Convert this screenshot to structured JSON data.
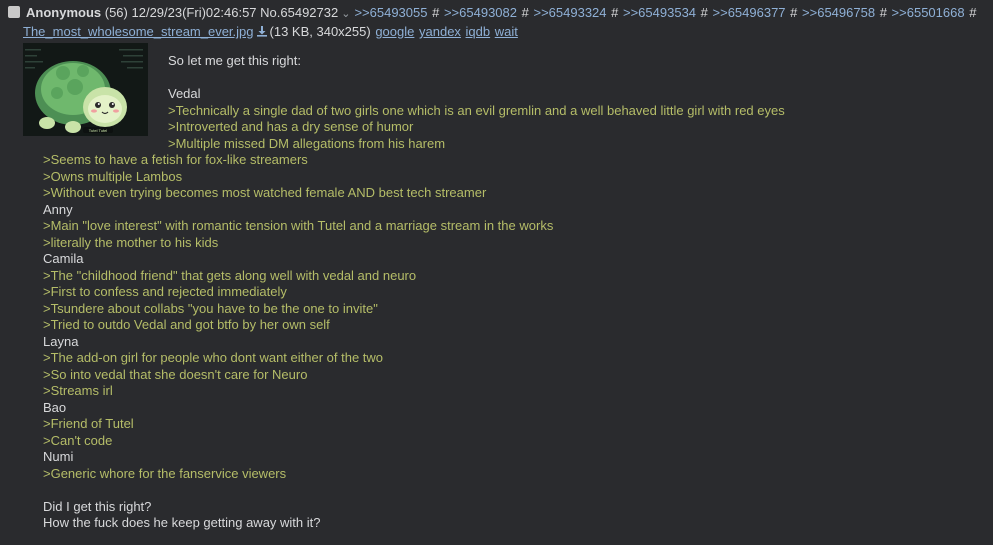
{
  "header": {
    "name": "Anonymous",
    "post_count": "(56)",
    "datetime": "12/29/23(Fri)02:46:57",
    "post_no": "No.65492732",
    "menu_icon": "chevron-down-icon",
    "backlinks": [
      ">>65493055",
      ">>65493082",
      ">>65493324",
      ">>65493534",
      ">>65496377",
      ">>65496758",
      ">>65501668"
    ],
    "backlink_sep": "#"
  },
  "file": {
    "filename": "The_most_wholesome_stream_ever.jpg",
    "download_icon": "download-icon",
    "info": "(13 KB, 340x255)",
    "search_links": [
      "google",
      "yandex",
      "iqdb",
      "wait"
    ],
    "thumb_caption": "Tutel Tutel"
  },
  "message_top": [
    {
      "text": "So let me get this right:",
      "green": false
    },
    {
      "text": "",
      "green": false
    },
    {
      "text": "Vedal",
      "green": false
    },
    {
      "text": ">Technically a single dad of two girls one which is an evil gremlin and a well behaved little girl with red eyes",
      "green": true
    },
    {
      "text": ">Introverted and has a dry sense of humor",
      "green": true
    },
    {
      "text": ">Multiple missed DM allegations from his harem",
      "green": true
    }
  ],
  "message_bottom": [
    {
      "text": ">Seems to have a fetish for fox-like streamers",
      "green": true
    },
    {
      "text": ">Owns multiple Lambos",
      "green": true
    },
    {
      "text": ">Without even trying becomes most watched female AND best tech streamer",
      "green": true
    },
    {
      "text": "Anny",
      "green": false
    },
    {
      "text": ">Main \"love interest\" with romantic tension with Tutel and a marriage stream in the works",
      "green": true
    },
    {
      "text": ">literally the mother to his kids",
      "green": true
    },
    {
      "text": "Camila",
      "green": false
    },
    {
      "text": ">The \"childhood friend\" that gets along well with vedal and neuro",
      "green": true
    },
    {
      "text": ">First to confess and rejected immediately",
      "green": true
    },
    {
      "text": ">Tsundere about collabs \"you have to be the one to invite\"",
      "green": true
    },
    {
      "text": ">Tried to outdo Vedal and got btfo by her own self",
      "green": true
    },
    {
      "text": "Layna",
      "green": false
    },
    {
      "text": ">The add-on girl for people who dont want either of the two",
      "green": true
    },
    {
      "text": ">So into vedal that she doesn't care for Neuro",
      "green": true
    },
    {
      "text": ">Streams irl",
      "green": true
    },
    {
      "text": "Bao",
      "green": false
    },
    {
      "text": ">Friend of Tutel",
      "green": true
    },
    {
      "text": ">Can't code",
      "green": true
    },
    {
      "text": "Numi",
      "green": false
    },
    {
      "text": ">Generic whore for the fanservice viewers",
      "green": true
    },
    {
      "text": "",
      "green": false
    },
    {
      "text": "Did I get this right?",
      "green": false
    },
    {
      "text": "How the fuck does he keep getting away with it?",
      "green": false
    }
  ],
  "colors": {
    "background": "#2a2b2e",
    "text": "#d8d9db",
    "greentext": "#b5bd68",
    "link": "#8fb0d6"
  }
}
